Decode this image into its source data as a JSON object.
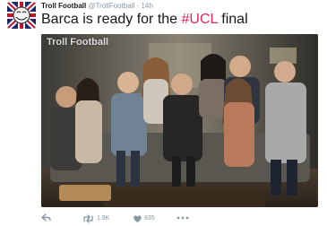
{
  "tweet": {
    "display_name": "Troll Football",
    "handle": "@TrollFootball",
    "separator": "·",
    "timestamp": "14h",
    "text_main": "Barca is ready for the ",
    "hashtag": "#UCL",
    "text_tail": " final",
    "avatar_icon": "union-jack-troll-face-avatar",
    "media": {
      "watermark": "Troll Football",
      "description_icon": "team-photo-on-couch"
    },
    "actions": {
      "reply_icon": "reply-arrow-icon",
      "retweet_icon": "retweet-icon",
      "retweet_count": "1.9K",
      "like_icon": "heart-icon",
      "like_count": "835",
      "more_icon": "more-dots-icon"
    },
    "colors": {
      "text": "#14171a",
      "muted": "#8899a6",
      "hashtag": "#e0245e"
    }
  }
}
